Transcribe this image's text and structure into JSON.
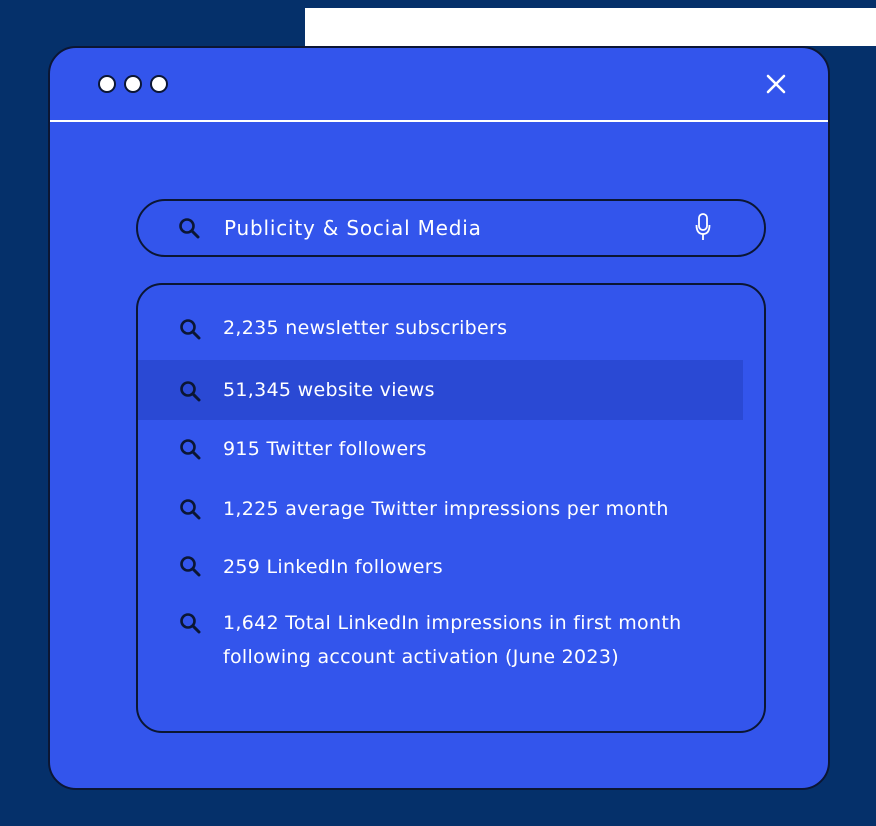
{
  "colors": {
    "background_navy": "#05306a",
    "window_blue": "#3355ec",
    "highlight_blue": "#2a49d4",
    "outline": "#0b1634",
    "text": "#ffffff"
  },
  "window": {
    "controls": [
      "circle",
      "circle",
      "circle"
    ],
    "close_icon": "close-icon"
  },
  "search": {
    "icon": "search-icon",
    "query": "Publicity & Social Media",
    "mic_icon": "microphone-icon"
  },
  "results": [
    {
      "text": " 2,235 newsletter subscribers",
      "highlighted": false
    },
    {
      "text": "51,345 website views",
      "highlighted": true
    },
    {
      "text": "915 Twitter followers",
      "highlighted": false
    },
    {
      "text": "1,225 average Twitter impressions per month",
      "highlighted": false
    },
    {
      "text": "259 LinkedIn followers",
      "highlighted": false
    },
    {
      "text": "1,642 Total LinkedIn impressions in first month following account activation (June 2023)",
      "highlighted": false
    }
  ]
}
